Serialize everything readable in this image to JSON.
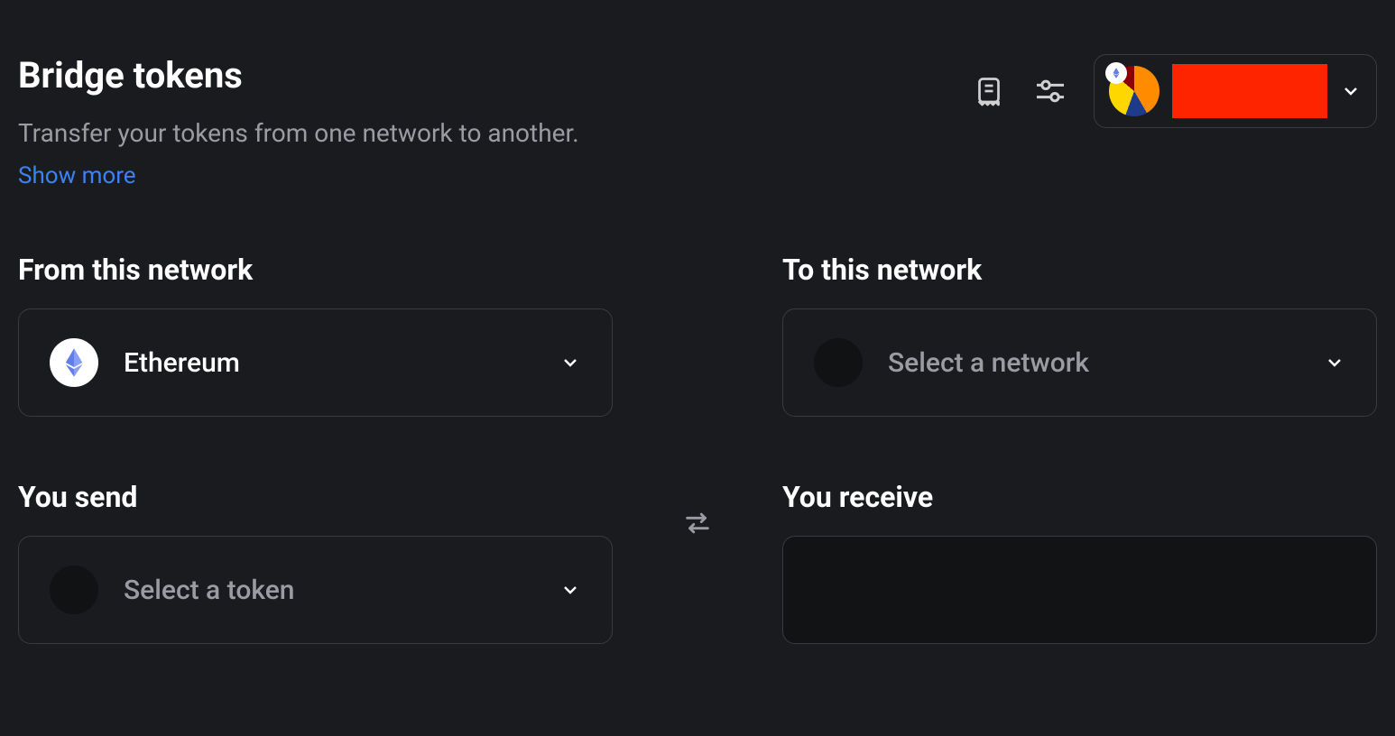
{
  "header": {
    "title": "Bridge tokens",
    "subtitle": "Transfer your tokens from one network to another.",
    "show_more": "Show more"
  },
  "icons": {
    "receipt": "receipt-icon",
    "settings": "settings-sliders-icon",
    "eth_small": "ethereum-icon"
  },
  "account": {
    "redacted": true
  },
  "from_network": {
    "label": "From this network",
    "selected": "Ethereum",
    "icon": "ethereum"
  },
  "to_network": {
    "label": "To this network",
    "placeholder": "Select a network"
  },
  "send": {
    "label": "You send",
    "placeholder": "Select a token"
  },
  "receive": {
    "label": "You receive"
  }
}
